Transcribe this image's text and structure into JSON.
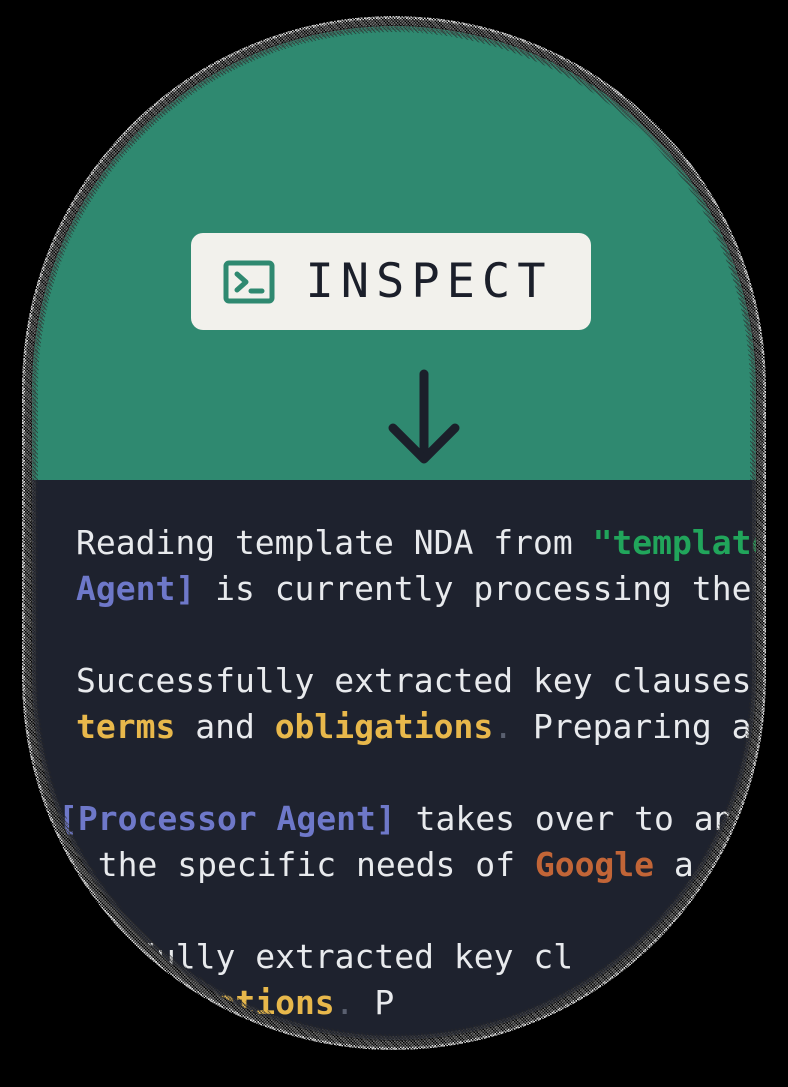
{
  "hero": {
    "badge": {
      "icon": "terminal-icon",
      "label": "INSPECT",
      "bg_color": "#F2F1EC",
      "text_color": "#1B1F2A",
      "icon_color": "#2F8970"
    },
    "arrow": {
      "icon": "arrow-down-icon",
      "color": "#1B1F2A"
    },
    "bg_color": "#2F8970"
  },
  "terminal": {
    "bg_color": "#1E222E",
    "text_color": "#E8EAED",
    "syntax_colors": {
      "string": "#21A55B",
      "agent": "#6E78C9",
      "keyword": "#E8B84B",
      "org": "#C26537",
      "punct": "#5A6070"
    },
    "blocks": [
      {
        "lines": [
          {
            "segments": [
              {
                "text": "Reading template NDA from ",
                "style": "plain"
              },
              {
                "text": "\"template_N",
                "style": "string"
              }
            ]
          },
          {
            "segments": [
              {
                "text": "Agent]",
                "style": "agent"
              },
              {
                "text": " is currently processing the fi",
                "style": "plain"
              }
            ]
          }
        ]
      },
      {
        "lines": [
          {
            "segments": [
              {
                "text": "Successfully extracted key clauses in",
                "style": "plain"
              }
            ]
          },
          {
            "segments": [
              {
                "text": "terms",
                "style": "keyword"
              },
              {
                "text": " and ",
                "style": "plain"
              },
              {
                "text": "obligations",
                "style": "keyword"
              },
              {
                "text": ".",
                "style": "punct"
              },
              {
                "text": " Preparing anal",
                "style": "plain"
              }
            ]
          }
        ]
      },
      {
        "lines": [
          {
            "segments": [
              {
                "text": "[Processor Agent]",
                "style": "agent"
              },
              {
                "text": " takes over to anal",
                "style": "plain"
              }
            ]
          },
          {
            "segments": [
              {
                "text": "r the specific needs of ",
                "style": "plain"
              },
              {
                "text": "Google",
                "style": "org"
              },
              {
                "text": " a",
                "style": "plain"
              }
            ]
          }
        ]
      },
      {
        "lines": [
          {
            "segments": [
              {
                "text": "fully extracted key cl",
                "style": "plain"
              }
            ]
          },
          {
            "segments": [
              {
                "text": "bligations",
                "style": "keyword"
              },
              {
                "text": ".",
                "style": "punct"
              },
              {
                "text": " P",
                "style": "plain"
              }
            ]
          }
        ]
      }
    ]
  }
}
